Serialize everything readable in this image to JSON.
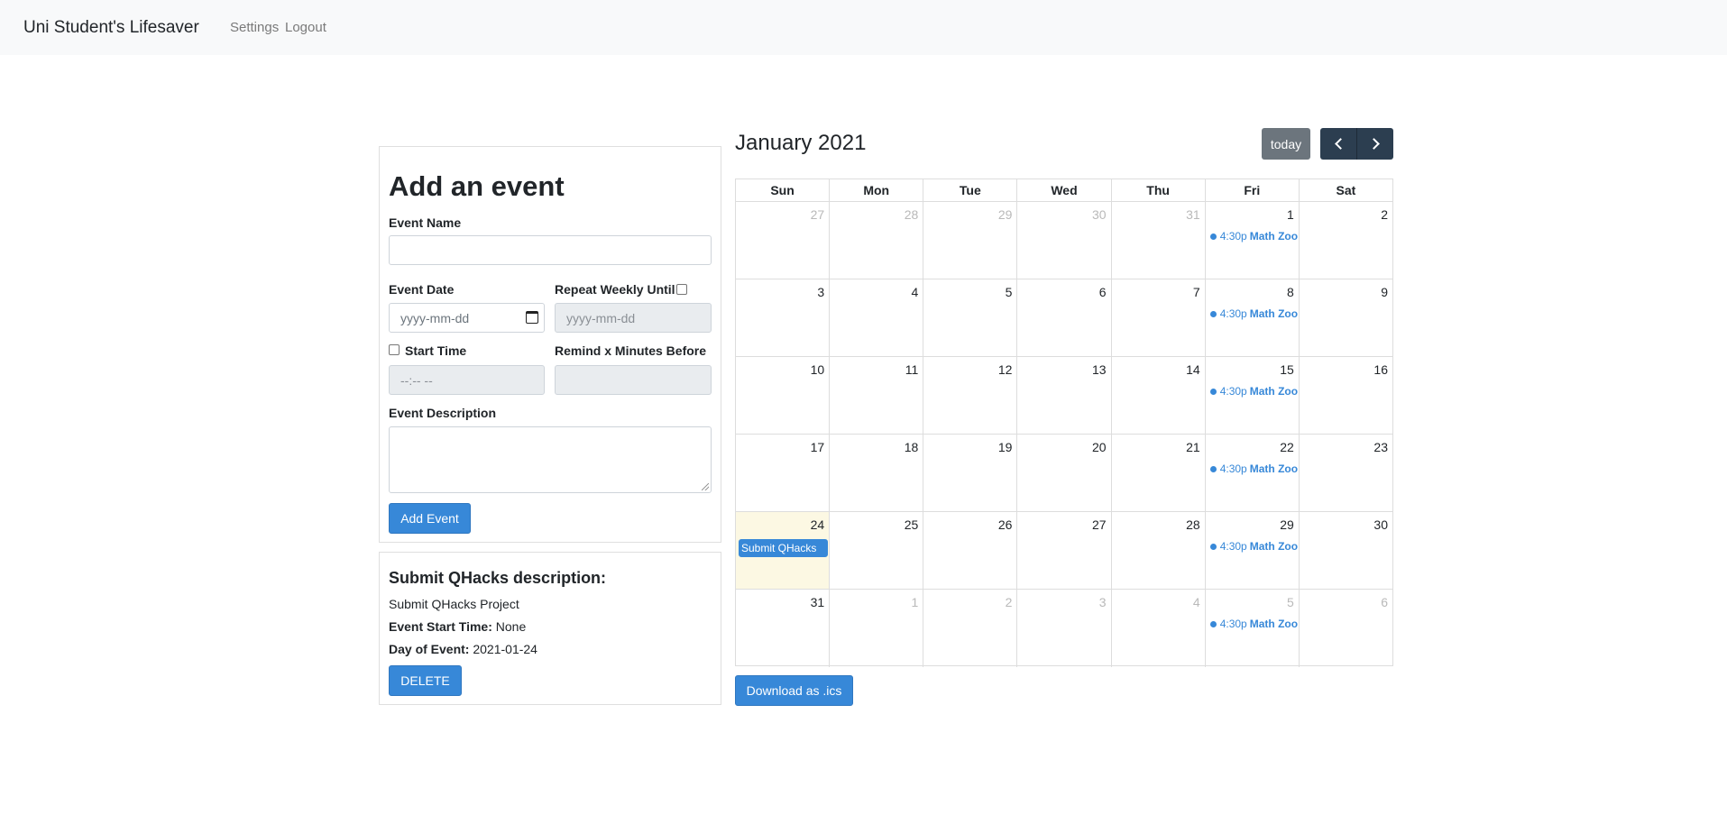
{
  "navbar": {
    "brand": "Uni Student's Lifesaver",
    "links": [
      "Settings",
      "Logout"
    ]
  },
  "form": {
    "title": "Add an event",
    "event_name_label": "Event Name",
    "event_name_value": "",
    "event_date_label": "Event Date",
    "event_date_placeholder": "yyyy-mm-dd",
    "repeat_label": "Repeat Weekly Until",
    "repeat_checked": false,
    "repeat_placeholder": "yyyy-mm-dd",
    "start_time_label": "Start Time",
    "start_time_checked": false,
    "start_time_placeholder": "--:-- --",
    "remind_label": "Remind x Minutes Before",
    "remind_value": "",
    "description_label": "Event Description",
    "description_value": "",
    "submit_label": "Add Event"
  },
  "details": {
    "title": "Submit QHacks description:",
    "description": "Submit QHacks Project",
    "start_time_label": "Event Start Time:",
    "start_time_value": "None",
    "day_label": "Day of Event:",
    "day_value": "2021-01-24",
    "delete_label": "DELETE"
  },
  "calendar": {
    "title": "January 2021",
    "today_label": "today",
    "weekdays": [
      "Sun",
      "Mon",
      "Tue",
      "Wed",
      "Thu",
      "Fri",
      "Sat"
    ],
    "weeks": [
      [
        {
          "d": "27",
          "other": true
        },
        {
          "d": "28",
          "other": true
        },
        {
          "d": "29",
          "other": true
        },
        {
          "d": "30",
          "other": true
        },
        {
          "d": "31",
          "other": true
        },
        {
          "d": "1",
          "event": {
            "time": "4:30p",
            "name": "Math Zoom"
          }
        },
        {
          "d": "2"
        }
      ],
      [
        {
          "d": "3"
        },
        {
          "d": "4"
        },
        {
          "d": "5"
        },
        {
          "d": "6"
        },
        {
          "d": "7"
        },
        {
          "d": "8",
          "event": {
            "time": "4:30p",
            "name": "Math Zoom"
          }
        },
        {
          "d": "9"
        }
      ],
      [
        {
          "d": "10"
        },
        {
          "d": "11"
        },
        {
          "d": "12"
        },
        {
          "d": "13"
        },
        {
          "d": "14"
        },
        {
          "d": "15",
          "event": {
            "time": "4:30p",
            "name": "Math Zoom"
          }
        },
        {
          "d": "16"
        }
      ],
      [
        {
          "d": "17"
        },
        {
          "d": "18"
        },
        {
          "d": "19"
        },
        {
          "d": "20"
        },
        {
          "d": "21"
        },
        {
          "d": "22",
          "event": {
            "time": "4:30p",
            "name": "Math Zoom"
          }
        },
        {
          "d": "23"
        }
      ],
      [
        {
          "d": "24",
          "today": true,
          "block": "Submit QHacks"
        },
        {
          "d": "25"
        },
        {
          "d": "26"
        },
        {
          "d": "27"
        },
        {
          "d": "28"
        },
        {
          "d": "29",
          "event": {
            "time": "4:30p",
            "name": "Math Zoom"
          }
        },
        {
          "d": "30"
        }
      ],
      [
        {
          "d": "31"
        },
        {
          "d": "1",
          "other": true
        },
        {
          "d": "2",
          "other": true
        },
        {
          "d": "3",
          "other": true
        },
        {
          "d": "4",
          "other": true
        },
        {
          "d": "5",
          "other": true,
          "event": {
            "time": "4:30p",
            "name": "Math Zoom"
          }
        },
        {
          "d": "6",
          "other": true
        }
      ]
    ],
    "download_label": "Download as .ics"
  },
  "colors": {
    "accent": "#3788d8",
    "nav_button": "#2c3e50",
    "today_button": "#6c757d",
    "today_highlight": "#fcf8e3"
  }
}
